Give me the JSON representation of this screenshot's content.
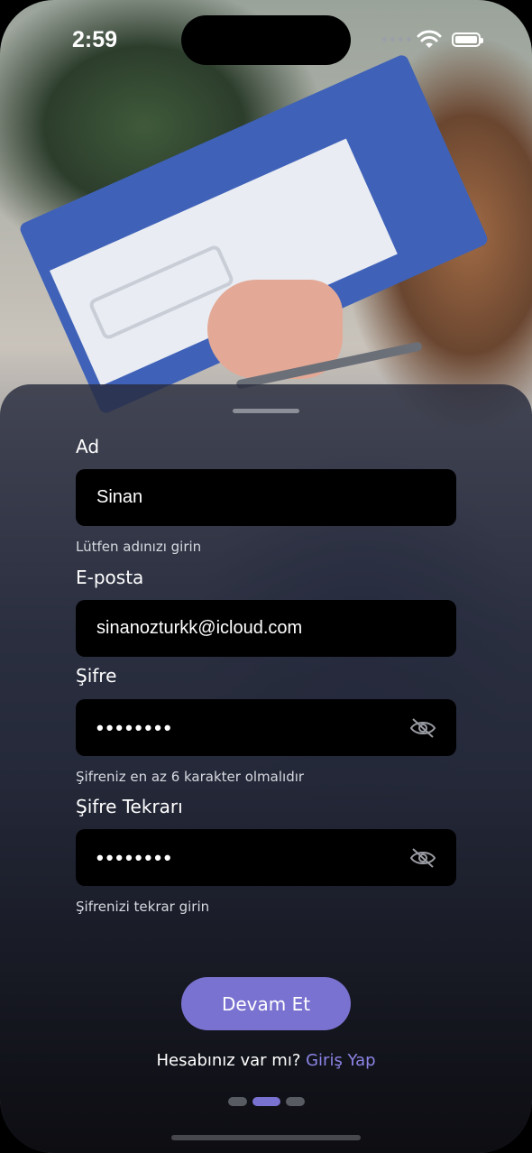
{
  "status_bar": {
    "time": "2:59"
  },
  "form": {
    "name_label": "Ad",
    "name_value": "Sinan",
    "name_hint": "Lütfen adınızı girin",
    "email_label": "E-posta",
    "email_value": "sinanozturkk@icloud.com",
    "password_label": "Şifre",
    "password_value": "••••••••",
    "password_hint": "Şifreniz en az 6 karakter olmalıdır",
    "password_repeat_label": "Şifre Tekrarı",
    "password_repeat_value": "••••••••",
    "password_repeat_hint": "Şifrenizi tekrar girin"
  },
  "actions": {
    "continue_label": "Devam Et",
    "have_account_text": "Hesabınız var mı?",
    "login_link": "Giriş Yap"
  },
  "pager": {
    "total": 3,
    "active_index": 1
  },
  "colors": {
    "accent": "#7a72d0",
    "link": "#8c84e6",
    "field_bg": "#000000"
  }
}
